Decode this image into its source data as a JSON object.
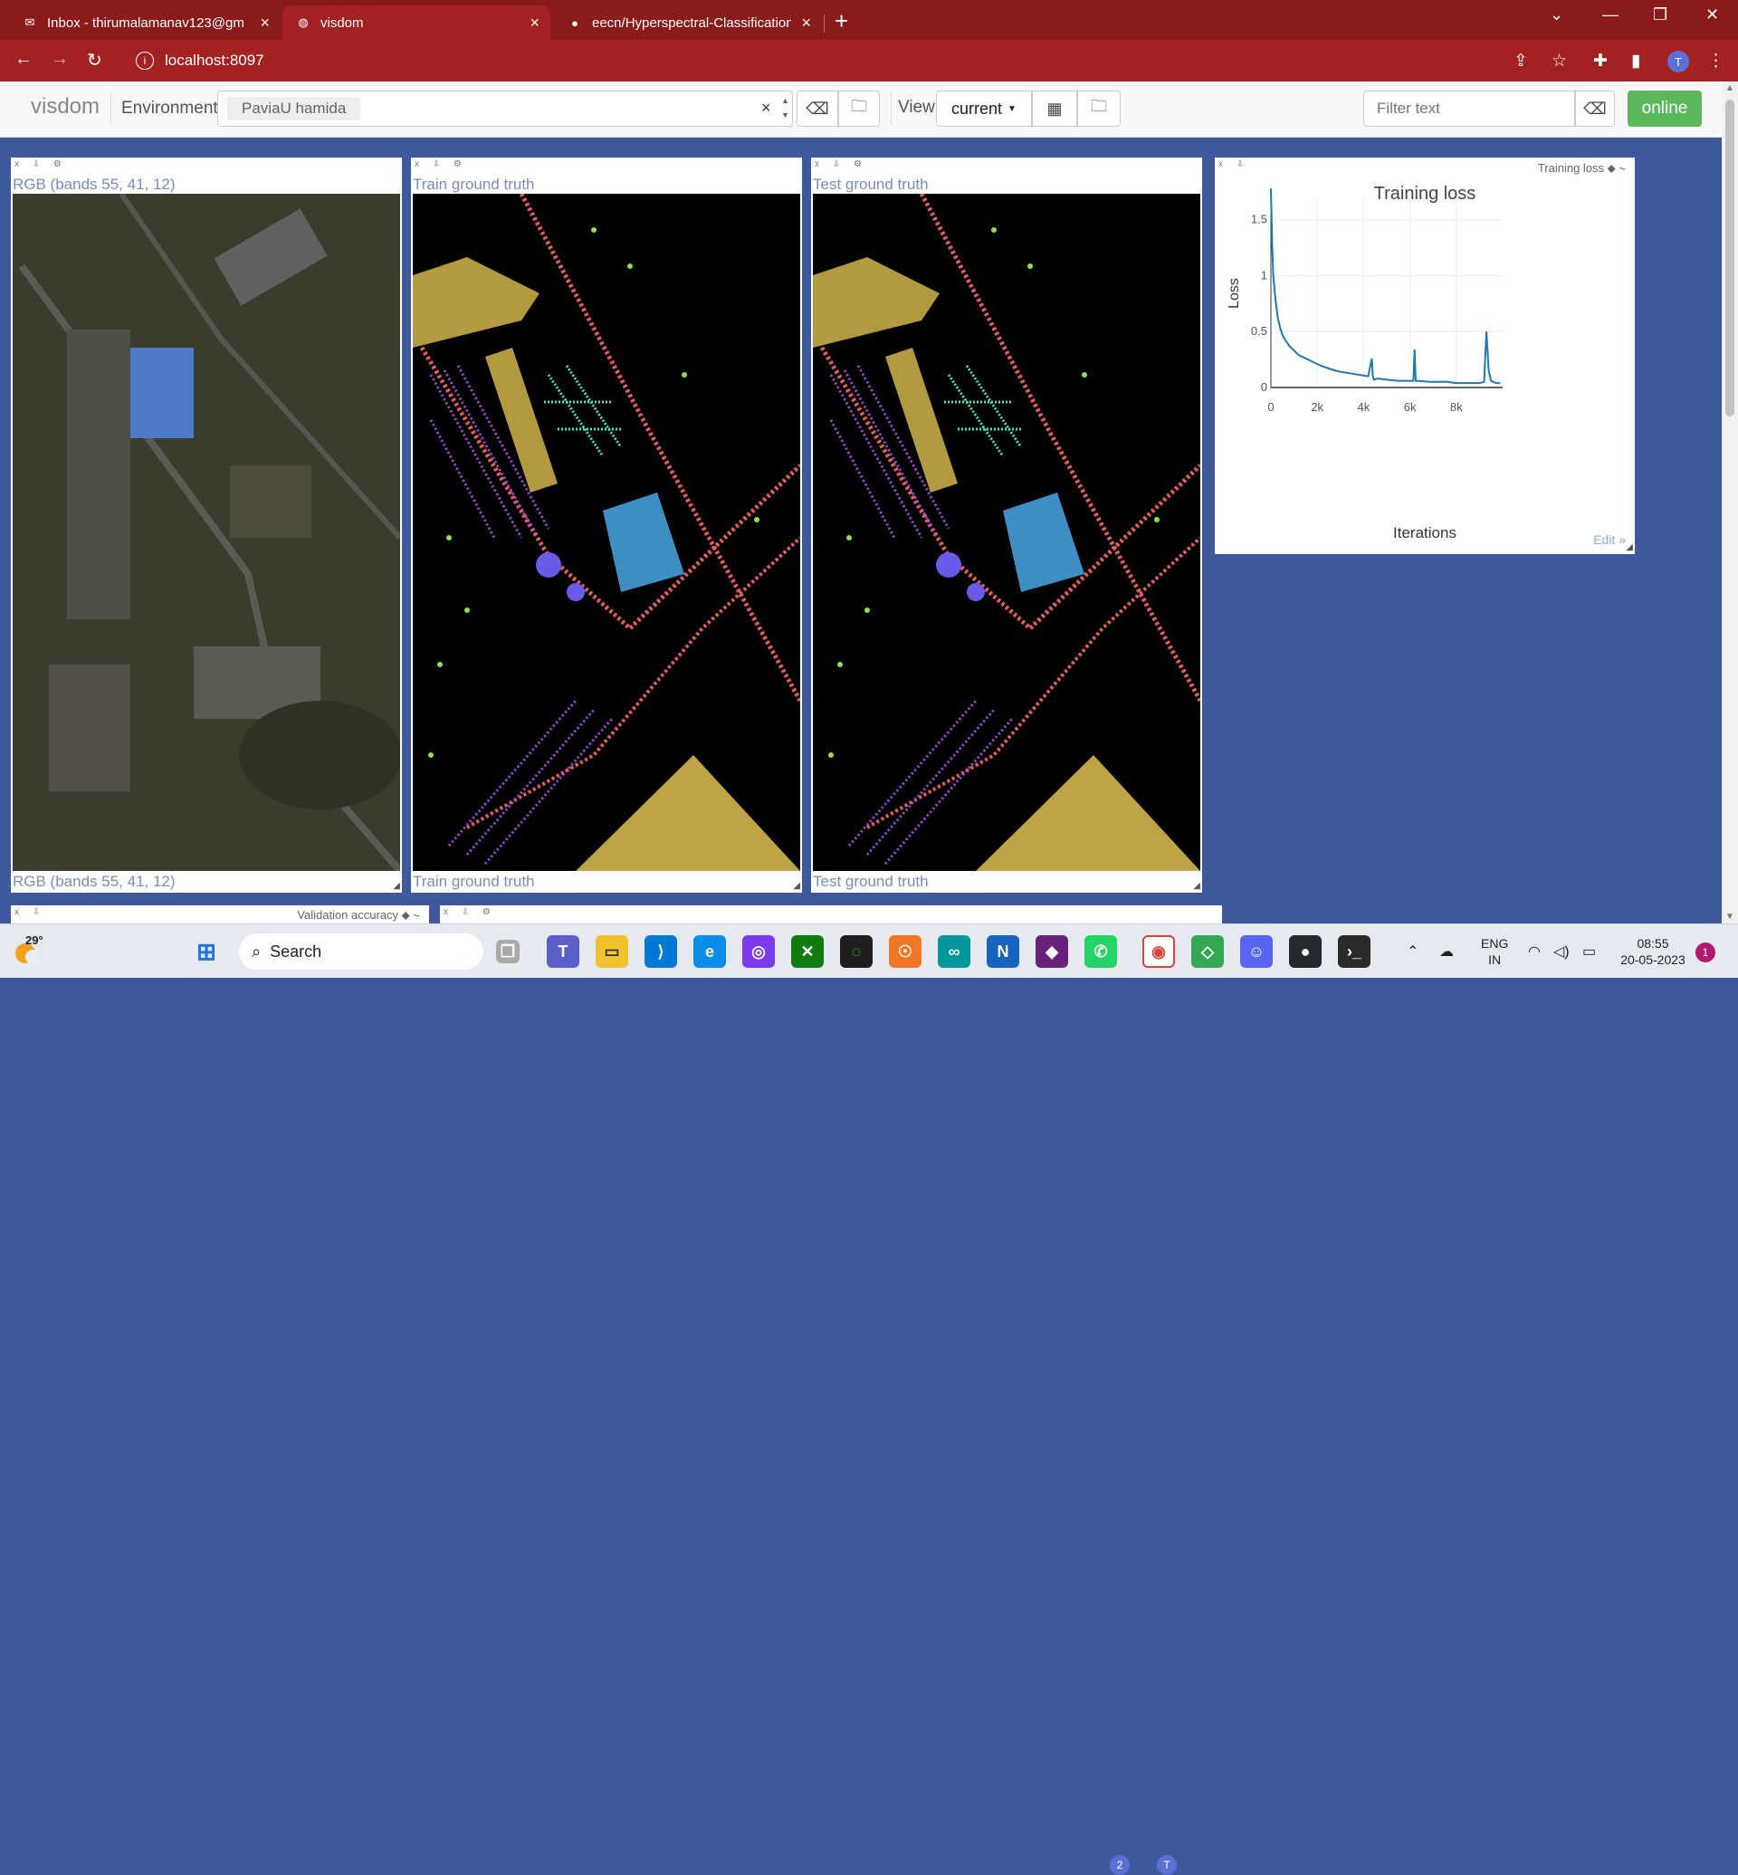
{
  "browser": {
    "tabs": [
      {
        "title": "Inbox - thirumalamanav123@gm",
        "icon": "gmail-icon"
      },
      {
        "title": "visdom",
        "icon": "globe-icon"
      },
      {
        "title": "eecn/Hyperspectral-Classification",
        "icon": "github-icon"
      }
    ],
    "url": "localhost:8097",
    "profile_initial": "T"
  },
  "visdom": {
    "logo": "visdom",
    "environment_label": "Environment",
    "environment_value": "PaviaU hamida",
    "view_label": "View",
    "view_value": "current",
    "filter_placeholder": "Filter text",
    "status": "online"
  },
  "panes": [
    {
      "title": "RGB (bands 55, 41, 12)"
    },
    {
      "title": "Train ground truth"
    },
    {
      "title": "Test ground truth"
    }
  ],
  "chart_pane": {
    "window_label": "Training loss",
    "edit_label": "Edit »"
  },
  "chart_data": {
    "type": "line",
    "title": "Training loss",
    "xlabel": "Iterations",
    "ylabel": "Loss",
    "xlim": [
      0,
      10000
    ],
    "ylim": [
      0,
      1.7
    ],
    "xticks": [
      "0",
      "2k",
      "4k",
      "6k",
      "8k"
    ],
    "yticks": [
      "0",
      "0.5",
      "1",
      "1.5"
    ],
    "color": "#1f77b4",
    "grid": true,
    "x": [
      0,
      50,
      100,
      200,
      300,
      400,
      500,
      600,
      800,
      1000,
      1200,
      1500,
      1800,
      2000,
      2200,
      2500,
      2800,
      3000,
      3300,
      3600,
      3900,
      4200,
      4350,
      4400,
      4450,
      4600,
      5000,
      5500,
      6000,
      6150,
      6200,
      6250,
      6400,
      6800,
      7200,
      7600,
      8000,
      8500,
      8800,
      9000,
      9200,
      9300,
      9400,
      9500,
      9700,
      9900
    ],
    "y": [
      1.78,
      1.3,
      1.0,
      0.78,
      0.62,
      0.53,
      0.47,
      0.43,
      0.37,
      0.33,
      0.29,
      0.26,
      0.23,
      0.21,
      0.19,
      0.17,
      0.15,
      0.14,
      0.13,
      0.12,
      0.11,
      0.1,
      0.26,
      0.1,
      0.07,
      0.08,
      0.07,
      0.06,
      0.06,
      0.06,
      0.34,
      0.06,
      0.06,
      0.05,
      0.05,
      0.05,
      0.04,
      0.04,
      0.04,
      0.04,
      0.05,
      0.5,
      0.15,
      0.06,
      0.04,
      0.04
    ]
  },
  "bottom_panes": [
    {
      "label": "Validation accuracy"
    },
    {
      "label": ""
    }
  ],
  "taskbar": {
    "temperature": "29°",
    "search_label": "Search",
    "language_line1": "ENG",
    "language_line2": "IN",
    "time": "08:55",
    "date": "20-05-2023",
    "notification_count": "1",
    "whatsapp_badge": "2",
    "chrome_badge": "T"
  }
}
